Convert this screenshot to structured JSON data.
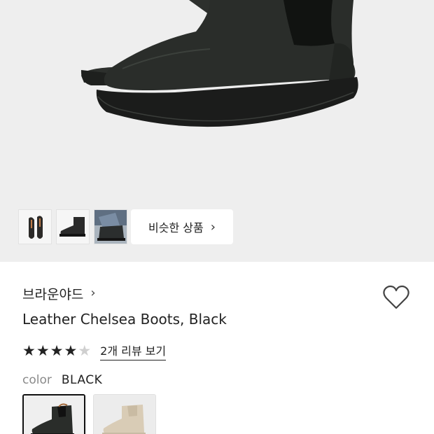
{
  "gallery": {
    "similar_label": "비슷한 상품",
    "similar_chevron": "›",
    "thumbnails": [
      {
        "name": "boot-pair-top-view"
      },
      {
        "name": "boot-side-view"
      },
      {
        "name": "boot-worn-view"
      }
    ]
  },
  "product": {
    "brand": "브라운야드",
    "brand_chevron": "›",
    "title": "Leather Chelsea Boots, Black",
    "rating": 4,
    "max_rating": 5,
    "review_link": "2개 리뷰 보기",
    "color_label": "color",
    "color_value": "BLACK",
    "swatches": [
      {
        "color": "BLACK",
        "selected": true
      },
      {
        "color": "BEIGE",
        "selected": false
      }
    ]
  },
  "colors": {
    "hero_bg": "#eeeeee",
    "boot_black": "#2a2d2a",
    "boot_beige": "#d9ccb6",
    "text": "#222222",
    "muted": "#8a8a8a"
  }
}
